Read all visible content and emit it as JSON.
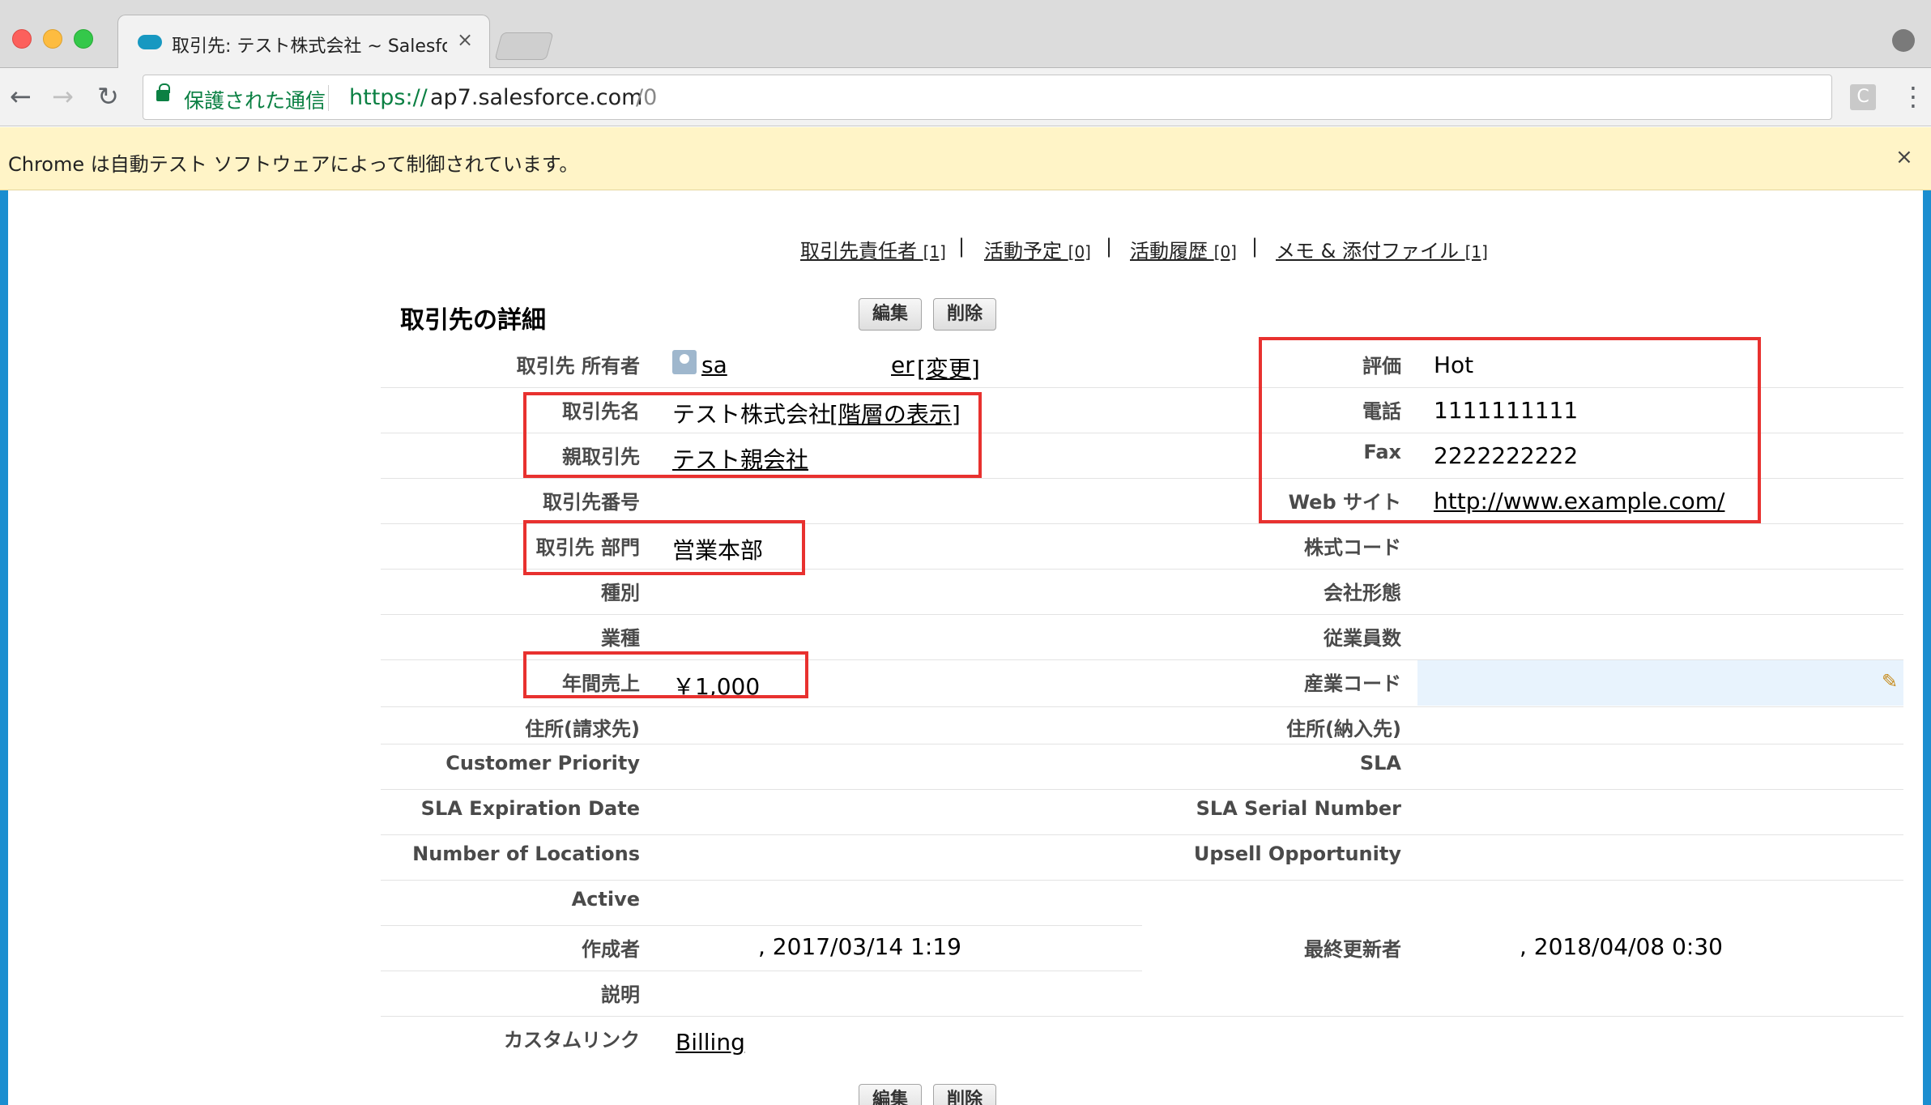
{
  "browser": {
    "tab_title": "取引先: テスト株式会社 ~ Salesfo",
    "tab_close": "×",
    "secure_label": "保護された通信",
    "url_scheme": "https://",
    "url_host": "ap7.salesforce.com",
    "url_path": "/0",
    "ext_label": "C",
    "infobar_text": "Chrome は自動テスト ソフトウェアによって制御されています。",
    "infobar_close": "×"
  },
  "related_links": [
    {
      "label": "取引先責任者",
      "count": "[1]"
    },
    {
      "label": "活動予定",
      "count": "[0]"
    },
    {
      "label": "活動履歴",
      "count": "[0]"
    },
    {
      "label": "メモ & 添付ファイル",
      "count": "[1]"
    }
  ],
  "separator": "|",
  "detail": {
    "title": "取引先の詳細",
    "edit_label": "編集",
    "delete_label": "削除"
  },
  "left_fields": {
    "owner_label": "取引先 所有者",
    "owner_value_a": "sa",
    "owner_value_b": "er",
    "owner_change": "[変更]",
    "account_name_label": "取引先名",
    "account_name_value": "テスト株式会社",
    "hierarchy_link": "[階層の表示]",
    "parent_label": "親取引先",
    "parent_value": "テスト親会社",
    "number_label": "取引先番号",
    "division_label": "取引先 部門",
    "division_value": "営業本部",
    "type_label": "種別",
    "industry_label": "業種",
    "revenue_label": "年間売上",
    "revenue_value": "￥1,000",
    "billing_label": "住所(請求先)",
    "priority_label": "Customer Priority",
    "sla_exp_label": "SLA Expiration Date",
    "locations_label": "Number of Locations",
    "active_label": "Active",
    "created_label": "作成者",
    "created_value": ", 2017/03/14 1:19",
    "description_label": "説明",
    "custom_links_label": "カスタムリンク",
    "billing_link": "Billing"
  },
  "right_fields": {
    "rating_label": "評価",
    "rating_value": "Hot",
    "phone_label": "電話",
    "phone_value": "1111111111",
    "fax_label": "Fax",
    "fax_value": "2222222222",
    "website_label": "Web サイト",
    "website_value": "http://www.example.com/",
    "ticker_label": "株式コード",
    "ownership_label": "会社形態",
    "employees_label": "従業員数",
    "sic_label": "産業コード",
    "shipping_label": "住所(納入先)",
    "sla_label": "SLA",
    "sla_serial_label": "SLA Serial Number",
    "upsell_label": "Upsell Opportunity",
    "modified_label": "最終更新者",
    "modified_value": ", 2018/04/08 0:30"
  },
  "colors": {
    "highlight": "#e8312f",
    "frame": "#1b8ed0",
    "infobar": "#fff4c7",
    "secure_green": "#0b8043"
  }
}
